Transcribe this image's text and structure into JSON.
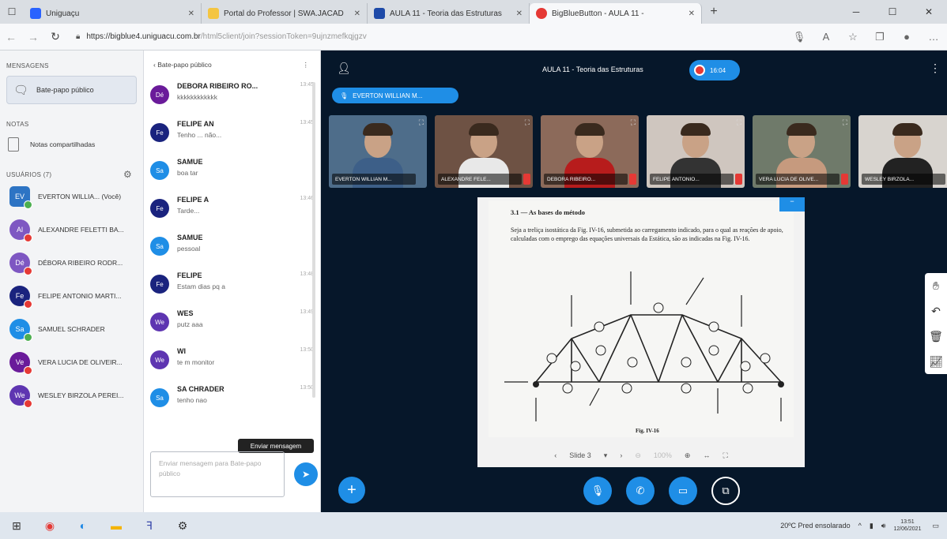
{
  "browser": {
    "tabs": [
      {
        "label": "Uniguaçu",
        "icon": "page-icon",
        "color": "#2962ff"
      },
      {
        "label": "Portal do Professor | SWA.JACAD",
        "icon": "page-icon",
        "color": "#f4c542"
      },
      {
        "label": "AULA 11 - Teoria das Estruturas",
        "icon": "page-icon",
        "color": "#1e4aa8"
      },
      {
        "label": "BigBlueButton - AULA 11 -",
        "icon": "record-icon",
        "color": "#e53935"
      }
    ],
    "url_host": "https://bigblue4.uniguacu.com.br",
    "url_path": "/html5client/join?sessionToken=9ujnzmefkqjgzv"
  },
  "userpanel": {
    "messages_heading": "MENSAGENS",
    "public_chat": "Bate-papo público",
    "notes_heading": "NOTAS",
    "shared_notes": "Notas compartilhadas",
    "users_heading": "USUÁRIOS (7)",
    "users": [
      {
        "initials": "EV",
        "name": "EVERTON WILLIA... (Você)",
        "color": "#2d74c4",
        "status": "#4caf50",
        "square": true
      },
      {
        "initials": "Al",
        "name": "ALEXANDRE FELETTI BA...",
        "color": "#7e57c2",
        "status": "#e53935"
      },
      {
        "initials": "Dé",
        "name": "DÉBORA RIBEIRO RODR...",
        "color": "#7e57c2",
        "status": "#e53935"
      },
      {
        "initials": "Fe",
        "name": "FELIPE ANTONIO MARTI...",
        "color": "#1a237e",
        "status": "#e53935"
      },
      {
        "initials": "Sa",
        "name": "SAMUEL SCHRADER",
        "color": "#1f8ee6",
        "status": "#4caf50"
      },
      {
        "initials": "Ve",
        "name": "VERA LUCIA DE OLIVEIR...",
        "color": "#6a1b9a",
        "status": "#e53935"
      },
      {
        "initials": "We",
        "name": "WESLEY BIRZOLA PEREI...",
        "color": "#5e35b1",
        "status": "#e53935"
      }
    ]
  },
  "chat": {
    "title": "Bate-papo público",
    "messages": [
      {
        "initials": "Dé",
        "color": "#6a1b9a",
        "name": "DEBORA RIBEIRO RO...",
        "time": "13:45",
        "text": "kkkkkkkkkkkk"
      },
      {
        "initials": "Fe",
        "color": "#1a237e",
        "name": "FELIPE AN",
        "time": "13:45",
        "text": "Tenho ...                não..."
      },
      {
        "initials": "Sa",
        "color": "#1f8ee6",
        "name": "SAMUE",
        "time": "",
        "text": "boa tar"
      },
      {
        "initials": "Fe",
        "color": "#1a237e",
        "name": "FELIPE A",
        "time": "13:46",
        "text": "Tarde..."
      },
      {
        "initials": "Sa",
        "color": "#1f8ee6",
        "name": "SAMUE",
        "time": "",
        "text": "pessoal"
      },
      {
        "initials": "Fe",
        "color": "#1a237e",
        "name": "FELIPE",
        "time": "13:48",
        "text": "Estam                dias pq a"
      },
      {
        "initials": "We",
        "color": "#5e35b1",
        "name": "WES",
        "time": "13:49",
        "text": "putz                  aaa"
      },
      {
        "initials": "We",
        "color": "#5e35b1",
        "name": "WI",
        "time": "13:50",
        "text": "te               m monitor"
      },
      {
        "initials": "Sa",
        "color": "#1f8ee6",
        "name": "SA    CHRADER",
        "time": "13:50",
        "text": "tenho nao"
      }
    ],
    "input_placeholder": "Enviar mensagem para Bate-papo público",
    "send_tooltip": "Enviar mensagem"
  },
  "meeting": {
    "title": "AULA 11 - Teoria das Estruturas",
    "recording_time": "16:04",
    "presenter": "EVERTON WILLIAN M...",
    "videos": [
      {
        "label": "EVERTON WILLIAN M...",
        "bg": "#4e6d8a",
        "shirt": "#3d5f88"
      },
      {
        "label": "ALEXANDRE FELE...",
        "bg": "#6e5244",
        "shirt": "#e8e8e8"
      },
      {
        "label": "DEBORA RIBEIRO...",
        "bg": "#8c6a5a",
        "shirt": "#b71c1c"
      },
      {
        "label": "FELIPE ANTONIO...",
        "bg": "#cfc6bf",
        "shirt": "#333"
      },
      {
        "label": "VERA LUCIA DE OLIVE...",
        "bg": "#6f7a6a",
        "shirt": "#c69a7e"
      },
      {
        "label": "WESLEY BIRZOLA...",
        "bg": "#d8d4cf",
        "shirt": "#222"
      }
    ],
    "slide": {
      "heading": "3.1 — As bases do método",
      "paragraph": "Seja a treliça isostática da Fig. IV-16, submetida ao carregamento indicado, para o qual as reações de apoio, calculadas com o emprego das equações universais da Estática, são as indicadas na Fig. IV-16.",
      "caption": "Fig. IV-16",
      "nav_label": "Slide 3",
      "zoom": "100%"
    }
  },
  "taskbar": {
    "weather": "20ºC  Pred ensolarado",
    "time": "13:51",
    "date": "12/06/2021"
  }
}
